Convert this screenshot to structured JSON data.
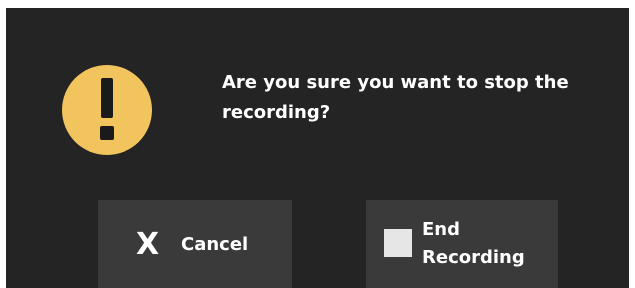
{
  "dialog": {
    "icon": "warning-exclamation-icon",
    "icon_color": "#f2c45e",
    "background_color": "#242424",
    "message": "Are you sure you want to stop the recording?"
  },
  "buttons": {
    "cancel": {
      "icon": "close-x-icon",
      "icon_glyph": "X",
      "label": "Cancel"
    },
    "end_recording": {
      "icon": "stop-square-icon",
      "label": "End Recording"
    }
  }
}
